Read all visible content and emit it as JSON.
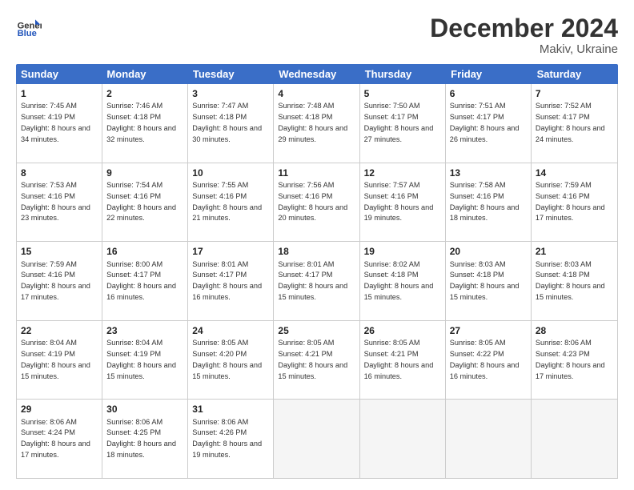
{
  "header": {
    "logo_line1": "General",
    "logo_line2": "Blue",
    "title": "December 2024",
    "subtitle": "Makiv, Ukraine"
  },
  "days": [
    "Sunday",
    "Monday",
    "Tuesday",
    "Wednesday",
    "Thursday",
    "Friday",
    "Saturday"
  ],
  "weeks": [
    [
      {
        "day": "1",
        "sunrise": "7:45 AM",
        "sunset": "4:19 PM",
        "daylight": "8 hours and 34 minutes."
      },
      {
        "day": "2",
        "sunrise": "7:46 AM",
        "sunset": "4:18 PM",
        "daylight": "8 hours and 32 minutes."
      },
      {
        "day": "3",
        "sunrise": "7:47 AM",
        "sunset": "4:18 PM",
        "daylight": "8 hours and 30 minutes."
      },
      {
        "day": "4",
        "sunrise": "7:48 AM",
        "sunset": "4:18 PM",
        "daylight": "8 hours and 29 minutes."
      },
      {
        "day": "5",
        "sunrise": "7:50 AM",
        "sunset": "4:17 PM",
        "daylight": "8 hours and 27 minutes."
      },
      {
        "day": "6",
        "sunrise": "7:51 AM",
        "sunset": "4:17 PM",
        "daylight": "8 hours and 26 minutes."
      },
      {
        "day": "7",
        "sunrise": "7:52 AM",
        "sunset": "4:17 PM",
        "daylight": "8 hours and 24 minutes."
      }
    ],
    [
      {
        "day": "8",
        "sunrise": "7:53 AM",
        "sunset": "4:16 PM",
        "daylight": "8 hours and 23 minutes."
      },
      {
        "day": "9",
        "sunrise": "7:54 AM",
        "sunset": "4:16 PM",
        "daylight": "8 hours and 22 minutes."
      },
      {
        "day": "10",
        "sunrise": "7:55 AM",
        "sunset": "4:16 PM",
        "daylight": "8 hours and 21 minutes."
      },
      {
        "day": "11",
        "sunrise": "7:56 AM",
        "sunset": "4:16 PM",
        "daylight": "8 hours and 20 minutes."
      },
      {
        "day": "12",
        "sunrise": "7:57 AM",
        "sunset": "4:16 PM",
        "daylight": "8 hours and 19 minutes."
      },
      {
        "day": "13",
        "sunrise": "7:58 AM",
        "sunset": "4:16 PM",
        "daylight": "8 hours and 18 minutes."
      },
      {
        "day": "14",
        "sunrise": "7:59 AM",
        "sunset": "4:16 PM",
        "daylight": "8 hours and 17 minutes."
      }
    ],
    [
      {
        "day": "15",
        "sunrise": "7:59 AM",
        "sunset": "4:16 PM",
        "daylight": "8 hours and 17 minutes."
      },
      {
        "day": "16",
        "sunrise": "8:00 AM",
        "sunset": "4:17 PM",
        "daylight": "8 hours and 16 minutes."
      },
      {
        "day": "17",
        "sunrise": "8:01 AM",
        "sunset": "4:17 PM",
        "daylight": "8 hours and 16 minutes."
      },
      {
        "day": "18",
        "sunrise": "8:01 AM",
        "sunset": "4:17 PM",
        "daylight": "8 hours and 15 minutes."
      },
      {
        "day": "19",
        "sunrise": "8:02 AM",
        "sunset": "4:18 PM",
        "daylight": "8 hours and 15 minutes."
      },
      {
        "day": "20",
        "sunrise": "8:03 AM",
        "sunset": "4:18 PM",
        "daylight": "8 hours and 15 minutes."
      },
      {
        "day": "21",
        "sunrise": "8:03 AM",
        "sunset": "4:18 PM",
        "daylight": "8 hours and 15 minutes."
      }
    ],
    [
      {
        "day": "22",
        "sunrise": "8:04 AM",
        "sunset": "4:19 PM",
        "daylight": "8 hours and 15 minutes."
      },
      {
        "day": "23",
        "sunrise": "8:04 AM",
        "sunset": "4:19 PM",
        "daylight": "8 hours and 15 minutes."
      },
      {
        "day": "24",
        "sunrise": "8:05 AM",
        "sunset": "4:20 PM",
        "daylight": "8 hours and 15 minutes."
      },
      {
        "day": "25",
        "sunrise": "8:05 AM",
        "sunset": "4:21 PM",
        "daylight": "8 hours and 15 minutes."
      },
      {
        "day": "26",
        "sunrise": "8:05 AM",
        "sunset": "4:21 PM",
        "daylight": "8 hours and 16 minutes."
      },
      {
        "day": "27",
        "sunrise": "8:05 AM",
        "sunset": "4:22 PM",
        "daylight": "8 hours and 16 minutes."
      },
      {
        "day": "28",
        "sunrise": "8:06 AM",
        "sunset": "4:23 PM",
        "daylight": "8 hours and 17 minutes."
      }
    ],
    [
      {
        "day": "29",
        "sunrise": "8:06 AM",
        "sunset": "4:24 PM",
        "daylight": "8 hours and 17 minutes."
      },
      {
        "day": "30",
        "sunrise": "8:06 AM",
        "sunset": "4:25 PM",
        "daylight": "8 hours and 18 minutes."
      },
      {
        "day": "31",
        "sunrise": "8:06 AM",
        "sunset": "4:26 PM",
        "daylight": "8 hours and 19 minutes."
      },
      null,
      null,
      null,
      null
    ]
  ]
}
